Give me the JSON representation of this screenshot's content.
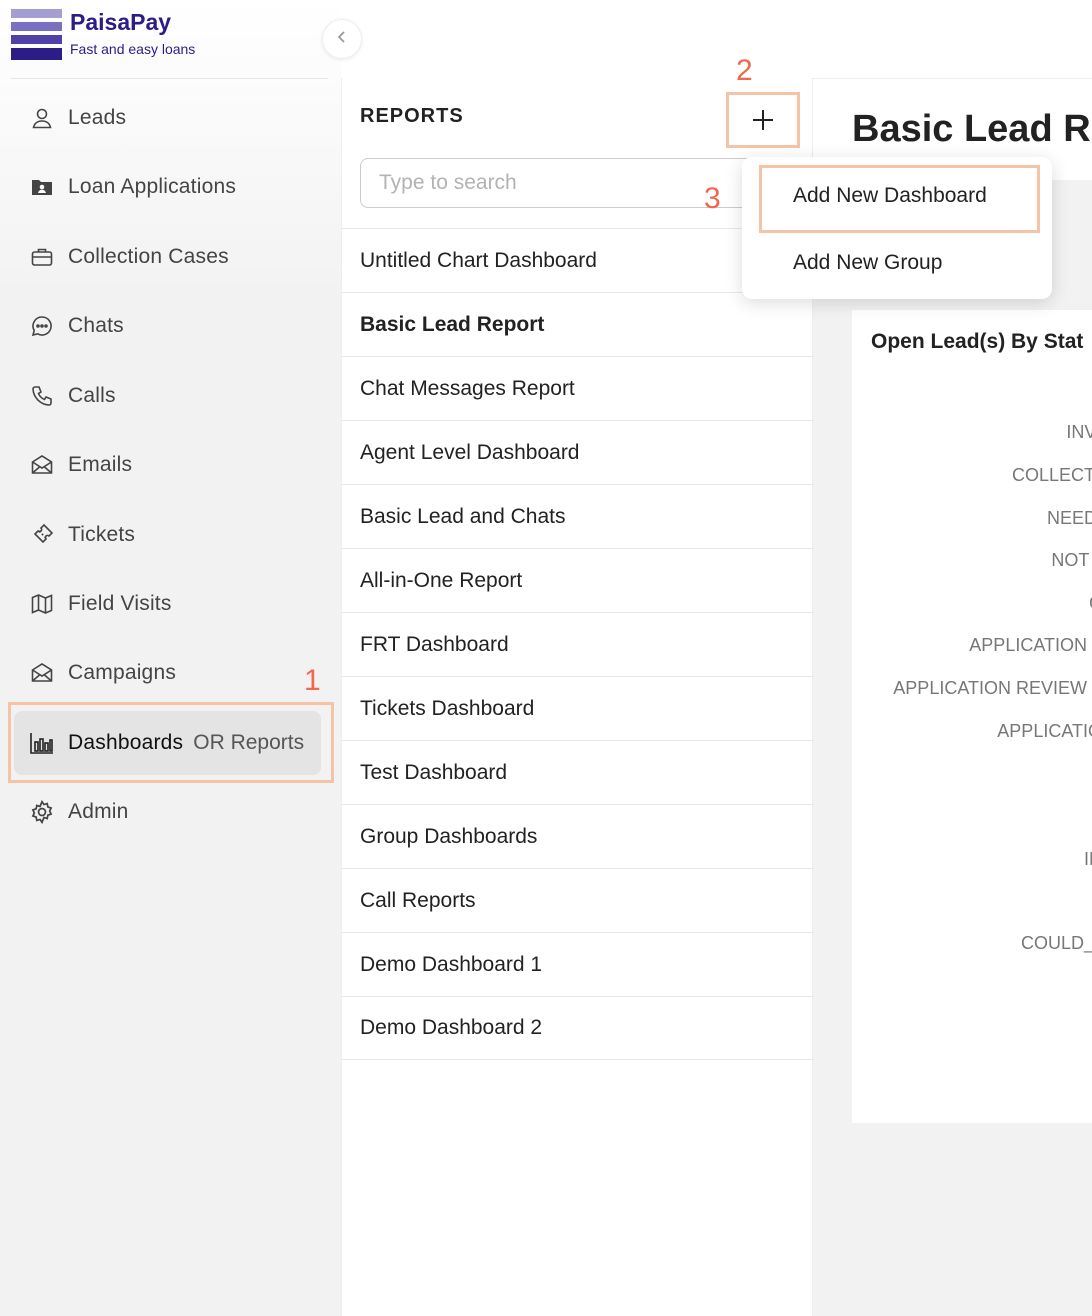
{
  "brand": {
    "name": "PaisaPay",
    "tagline": "Fast and easy loans"
  },
  "sidebar": {
    "items": [
      {
        "label": "Leads",
        "icon": "user-icon"
      },
      {
        "label": "Loan Applications",
        "icon": "folder-user-icon"
      },
      {
        "label": "Collection Cases",
        "icon": "briefcase-icon"
      },
      {
        "label": "Chats",
        "icon": "chat-bubble-icon"
      },
      {
        "label": "Calls",
        "icon": "phone-icon"
      },
      {
        "label": "Emails",
        "icon": "mail-icon"
      },
      {
        "label": "Tickets",
        "icon": "ticket-icon"
      },
      {
        "label": "Field Visits",
        "icon": "map-icon"
      },
      {
        "label": "Campaigns",
        "icon": "mail-open-icon"
      },
      {
        "label": "Dashboards",
        "suffix": "OR Reports",
        "icon": "bar-chart-icon",
        "active": true
      },
      {
        "label": "Admin",
        "icon": "gear-icon"
      }
    ]
  },
  "annotations": {
    "step1": "1",
    "step2": "2",
    "step3": "3",
    "color": "#f0684e",
    "box_color": "#f5c3a6"
  },
  "reports": {
    "title": "REPORTS",
    "add_symbol": "+",
    "search_placeholder": "Type to search",
    "items": [
      "Untitled Chart Dashboard",
      "Basic Lead Report",
      "Chat Messages Report",
      "Agent Level Dashboard",
      "Basic Lead and Chats",
      "All-in-One Report",
      "FRT Dashboard",
      "Tickets Dashboard",
      "Test Dashboard",
      "Group Dashboards",
      "Call Reports",
      "Demo Dashboard 1",
      "Demo Dashboard 2"
    ],
    "selected": "Basic Lead Report"
  },
  "dropdown": {
    "items": [
      "Add New Dashboard",
      "Add New Group"
    ]
  },
  "main": {
    "title": "Basic Lead Re",
    "card": {
      "title": "Open Lead(s) By Stat",
      "axis_labels": [
        "INVALI",
        "COLLECT",
        "NEED M",
        "NOT IN",
        "C",
        "APPLICATION S",
        "APPLICATION REVIEW",
        "APPLICATIO",
        "IN",
        "COULD_N"
      ]
    }
  },
  "colors": {
    "brand": "#2b1c86",
    "logo_light": "#9b93c9",
    "logo_mid": "#5b4fb0",
    "logo_dark": "#2b1c86"
  }
}
